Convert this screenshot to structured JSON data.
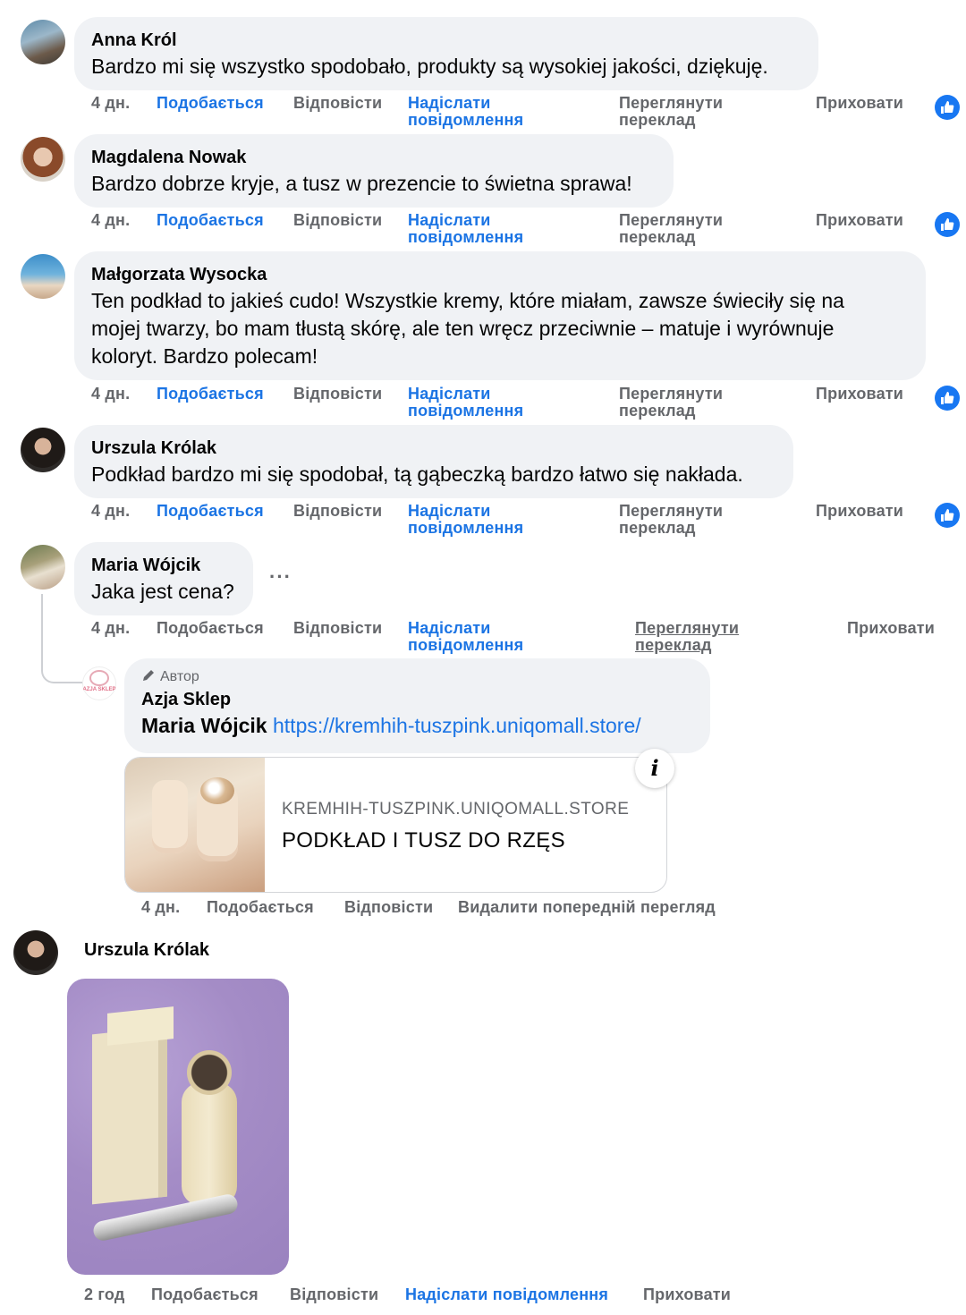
{
  "comments": [
    {
      "author": "Anna Król",
      "lines": [
        "Bardzo mi się wszystko spodobało, produkty są wysokiej jakości, dziękuję."
      ]
    },
    {
      "author": "Magdalena Nowak",
      "lines": [
        "Bardzo dobrze kryje, a tusz w prezencie to świetna sprawa!"
      ]
    },
    {
      "author": "Małgorzata Wysocka",
      "lines": [
        "Ten podkład to jakieś cudo! Wszystkie kremy, które miałam, zawsze świeciły się na",
        "mojej twarzy, bo mam tłustą skórę, ale ten wręcz przeciwnie – matuje i wyrównuje",
        "koloryt. Bardzo polecam!"
      ]
    },
    {
      "author": "Urszula Królak",
      "lines": [
        "Podkład bardzo mi się spodobał, tą gąbeczką bardzo łatwo się nakłada."
      ]
    },
    {
      "author": "Maria Wójcik",
      "lines": [
        "Jaka jest cena?"
      ]
    }
  ],
  "actions": {
    "time": "4 дн.",
    "like": "Подобається",
    "reply": "Відповісти",
    "send_1": "Надіслати",
    "send_2": "повідомлення",
    "translate_1": "Переглянути",
    "translate_2": "переклад",
    "hide": "Приховати"
  },
  "more_label": "···",
  "reply": {
    "badge": "Автор",
    "author": "Azja Sklep",
    "mention": "Maria Wójcik",
    "link": "https://kremhih-tuszpink.uniqomall.store/",
    "avatar_text": "AZJA SKLEP",
    "preview": {
      "domain": "KREMHIH-TUSZPINK.UNIQOMALL.STORE",
      "title": "PODKŁAD I TUSZ DO RZĘS"
    },
    "info_icon": "i",
    "time": "4 дн.",
    "like": "Подобається",
    "reply": "Відповісти",
    "remove_preview": "Видалити попередній перегляд"
  },
  "last": {
    "author": "Urszula Królak",
    "time": "2 год",
    "like": "Подобається",
    "reply": "Відповісти",
    "send": "Надіслати повідомлення",
    "hide": "Приховати"
  },
  "icons": {
    "like": "thumbs-up-icon",
    "more": "more-dots-icon",
    "pencil": "pencil-icon",
    "info": "info-icon"
  },
  "colors": {
    "link": "#1b74e4",
    "like_badge": "#1877f2",
    "bubble": "#f0f2f5",
    "meta": "#65676b",
    "photo_bg": "#a98fc9"
  }
}
